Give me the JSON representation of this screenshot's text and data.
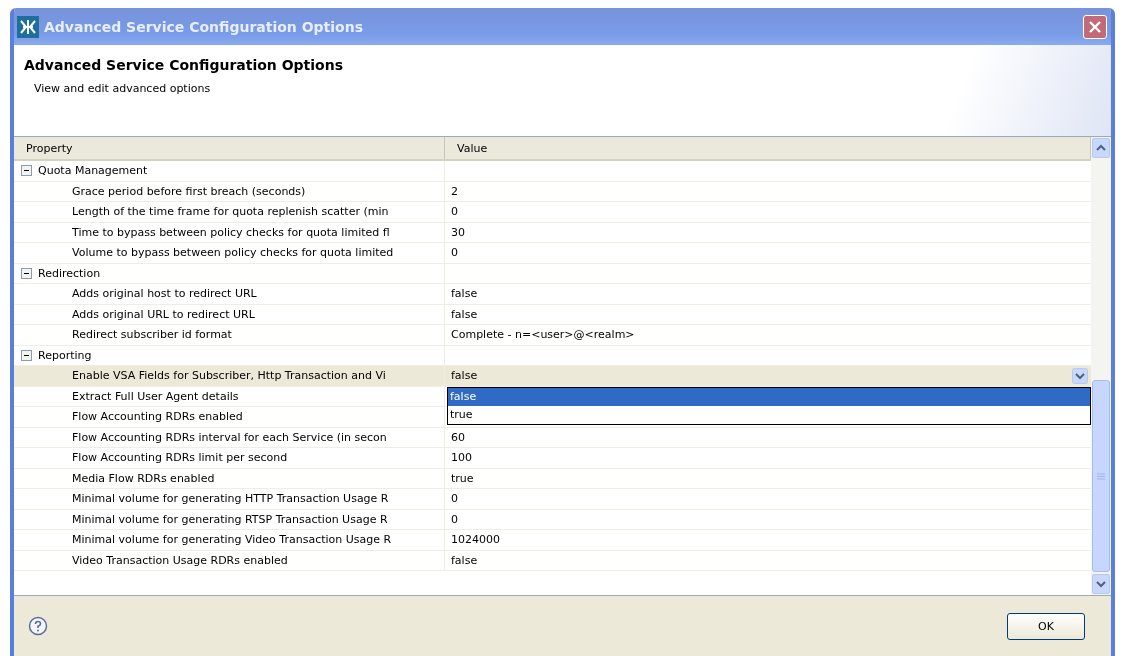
{
  "window": {
    "title": "Advanced Service Configuration Options"
  },
  "header": {
    "title": "Advanced Service Configuration Options",
    "subtitle": "View and edit advanced options"
  },
  "table": {
    "columns": [
      "Property",
      "Value"
    ],
    "groups": [
      {
        "name": "Quota Management",
        "expanded": true,
        "children": [
          {
            "property": "Grace period before first breach (seconds)",
            "value": "2",
            "selected": false
          },
          {
            "property": "Length of the time frame for quota replenish scatter (min",
            "value": "0",
            "selected": false
          },
          {
            "property": "Time to bypass between policy checks for quota limited fl",
            "value": "30",
            "selected": false
          },
          {
            "property": "Volume to bypass between policy checks for quota limited",
            "value": "0",
            "selected": false
          }
        ]
      },
      {
        "name": "Redirection",
        "expanded": true,
        "children": [
          {
            "property": "Adds original host to redirect URL",
            "value": "false",
            "selected": false
          },
          {
            "property": "Adds original URL to redirect URL",
            "value": "false",
            "selected": false
          },
          {
            "property": "Redirect subscriber id format",
            "value": "Complete - n=<user>@<realm>",
            "selected": false
          }
        ]
      },
      {
        "name": "Reporting",
        "expanded": true,
        "children": [
          {
            "property": "Enable VSA Fields for Subscriber, Http Transaction and Vi",
            "value": "false",
            "selected": true,
            "options": [
              {
                "label": "false",
                "selected": true
              },
              {
                "label": "true",
                "selected": false
              }
            ]
          },
          {
            "property": "Extract Full User Agent details",
            "selected": false
          },
          {
            "property": "Flow Accounting RDRs enabled",
            "selected": false
          },
          {
            "property": "Flow Accounting RDRs interval for each Service (in secon",
            "value": "60",
            "selected": false
          },
          {
            "property": "Flow Accounting RDRs limit per second",
            "value": "100",
            "selected": false
          },
          {
            "property": "Media Flow RDRs enabled",
            "value": "true",
            "selected": false
          },
          {
            "property": "Minimal volume for generating HTTP Transaction Usage R",
            "value": "0",
            "selected": false
          },
          {
            "property": "Minimal volume for generating RTSP Transaction Usage R",
            "value": "0",
            "selected": false
          },
          {
            "property": "Minimal volume for generating Video Transaction Usage R",
            "value": "1024000",
            "selected": false
          },
          {
            "property": "Video Transaction Usage RDRs enabled",
            "value": "false",
            "selected": false
          }
        ]
      }
    ]
  },
  "buttons": [
    "OK"
  ]
}
